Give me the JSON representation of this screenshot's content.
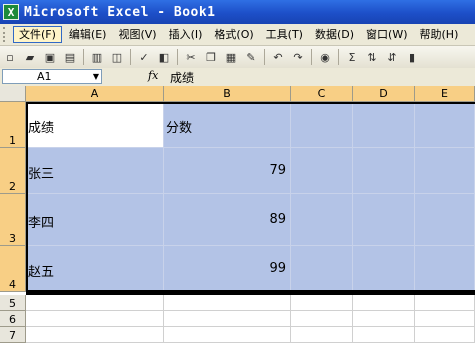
{
  "window": {
    "title": "Microsoft Excel - Book1",
    "app_icon_glyph": "X"
  },
  "menu": {
    "items": [
      "文件(F)",
      "编辑(E)",
      "视图(V)",
      "插入(I)",
      "格式(O)",
      "工具(T)",
      "数据(D)",
      "窗口(W)",
      "帮助(H)"
    ],
    "active_index": 0
  },
  "toolbar": {
    "icons": [
      "new-icon",
      "open-icon",
      "save-icon",
      "permission-icon",
      "print-icon",
      "print-preview-icon",
      "spelling-icon",
      "research-icon",
      "cut-icon",
      "copy-icon",
      "paste-icon",
      "format-painter-icon",
      "undo-icon",
      "redo-icon",
      "hyperlink-icon",
      "autosum-icon",
      "sort-ascending-icon",
      "sort-descending-icon",
      "chart-wizard-icon"
    ],
    "glyphs": {
      "new-icon": "▫",
      "open-icon": "▰",
      "save-icon": "▣",
      "permission-icon": "▤",
      "print-icon": "▥",
      "print-preview-icon": "◫",
      "spelling-icon": "✓",
      "research-icon": "◧",
      "cut-icon": "✂",
      "copy-icon": "❐",
      "paste-icon": "▦",
      "format-painter-icon": "✎",
      "undo-icon": "↶",
      "redo-icon": "↷",
      "hyperlink-icon": "◉",
      "autosum-icon": "Σ",
      "sort-ascending-icon": "⇅",
      "sort-descending-icon": "⇵",
      "chart-wizard-icon": "▮"
    }
  },
  "formula_bar": {
    "name_box": "A1",
    "fx": "fx",
    "value": "成绩"
  },
  "columns": [
    "A",
    "B",
    "C",
    "D",
    "E"
  ],
  "rows": [
    "1",
    "2",
    "3",
    "4",
    "5",
    "6",
    "7"
  ],
  "cells": {
    "A1": "成绩",
    "B1": "分数",
    "A2": "张三",
    "B2": "79",
    "A3": "李四",
    "B3": "89",
    "A4": "赵五",
    "B4": "99"
  },
  "colors": {
    "selection": "#b3c3e6",
    "header_selected": "#f8cf85",
    "title_bar": "#1d4fc8"
  }
}
